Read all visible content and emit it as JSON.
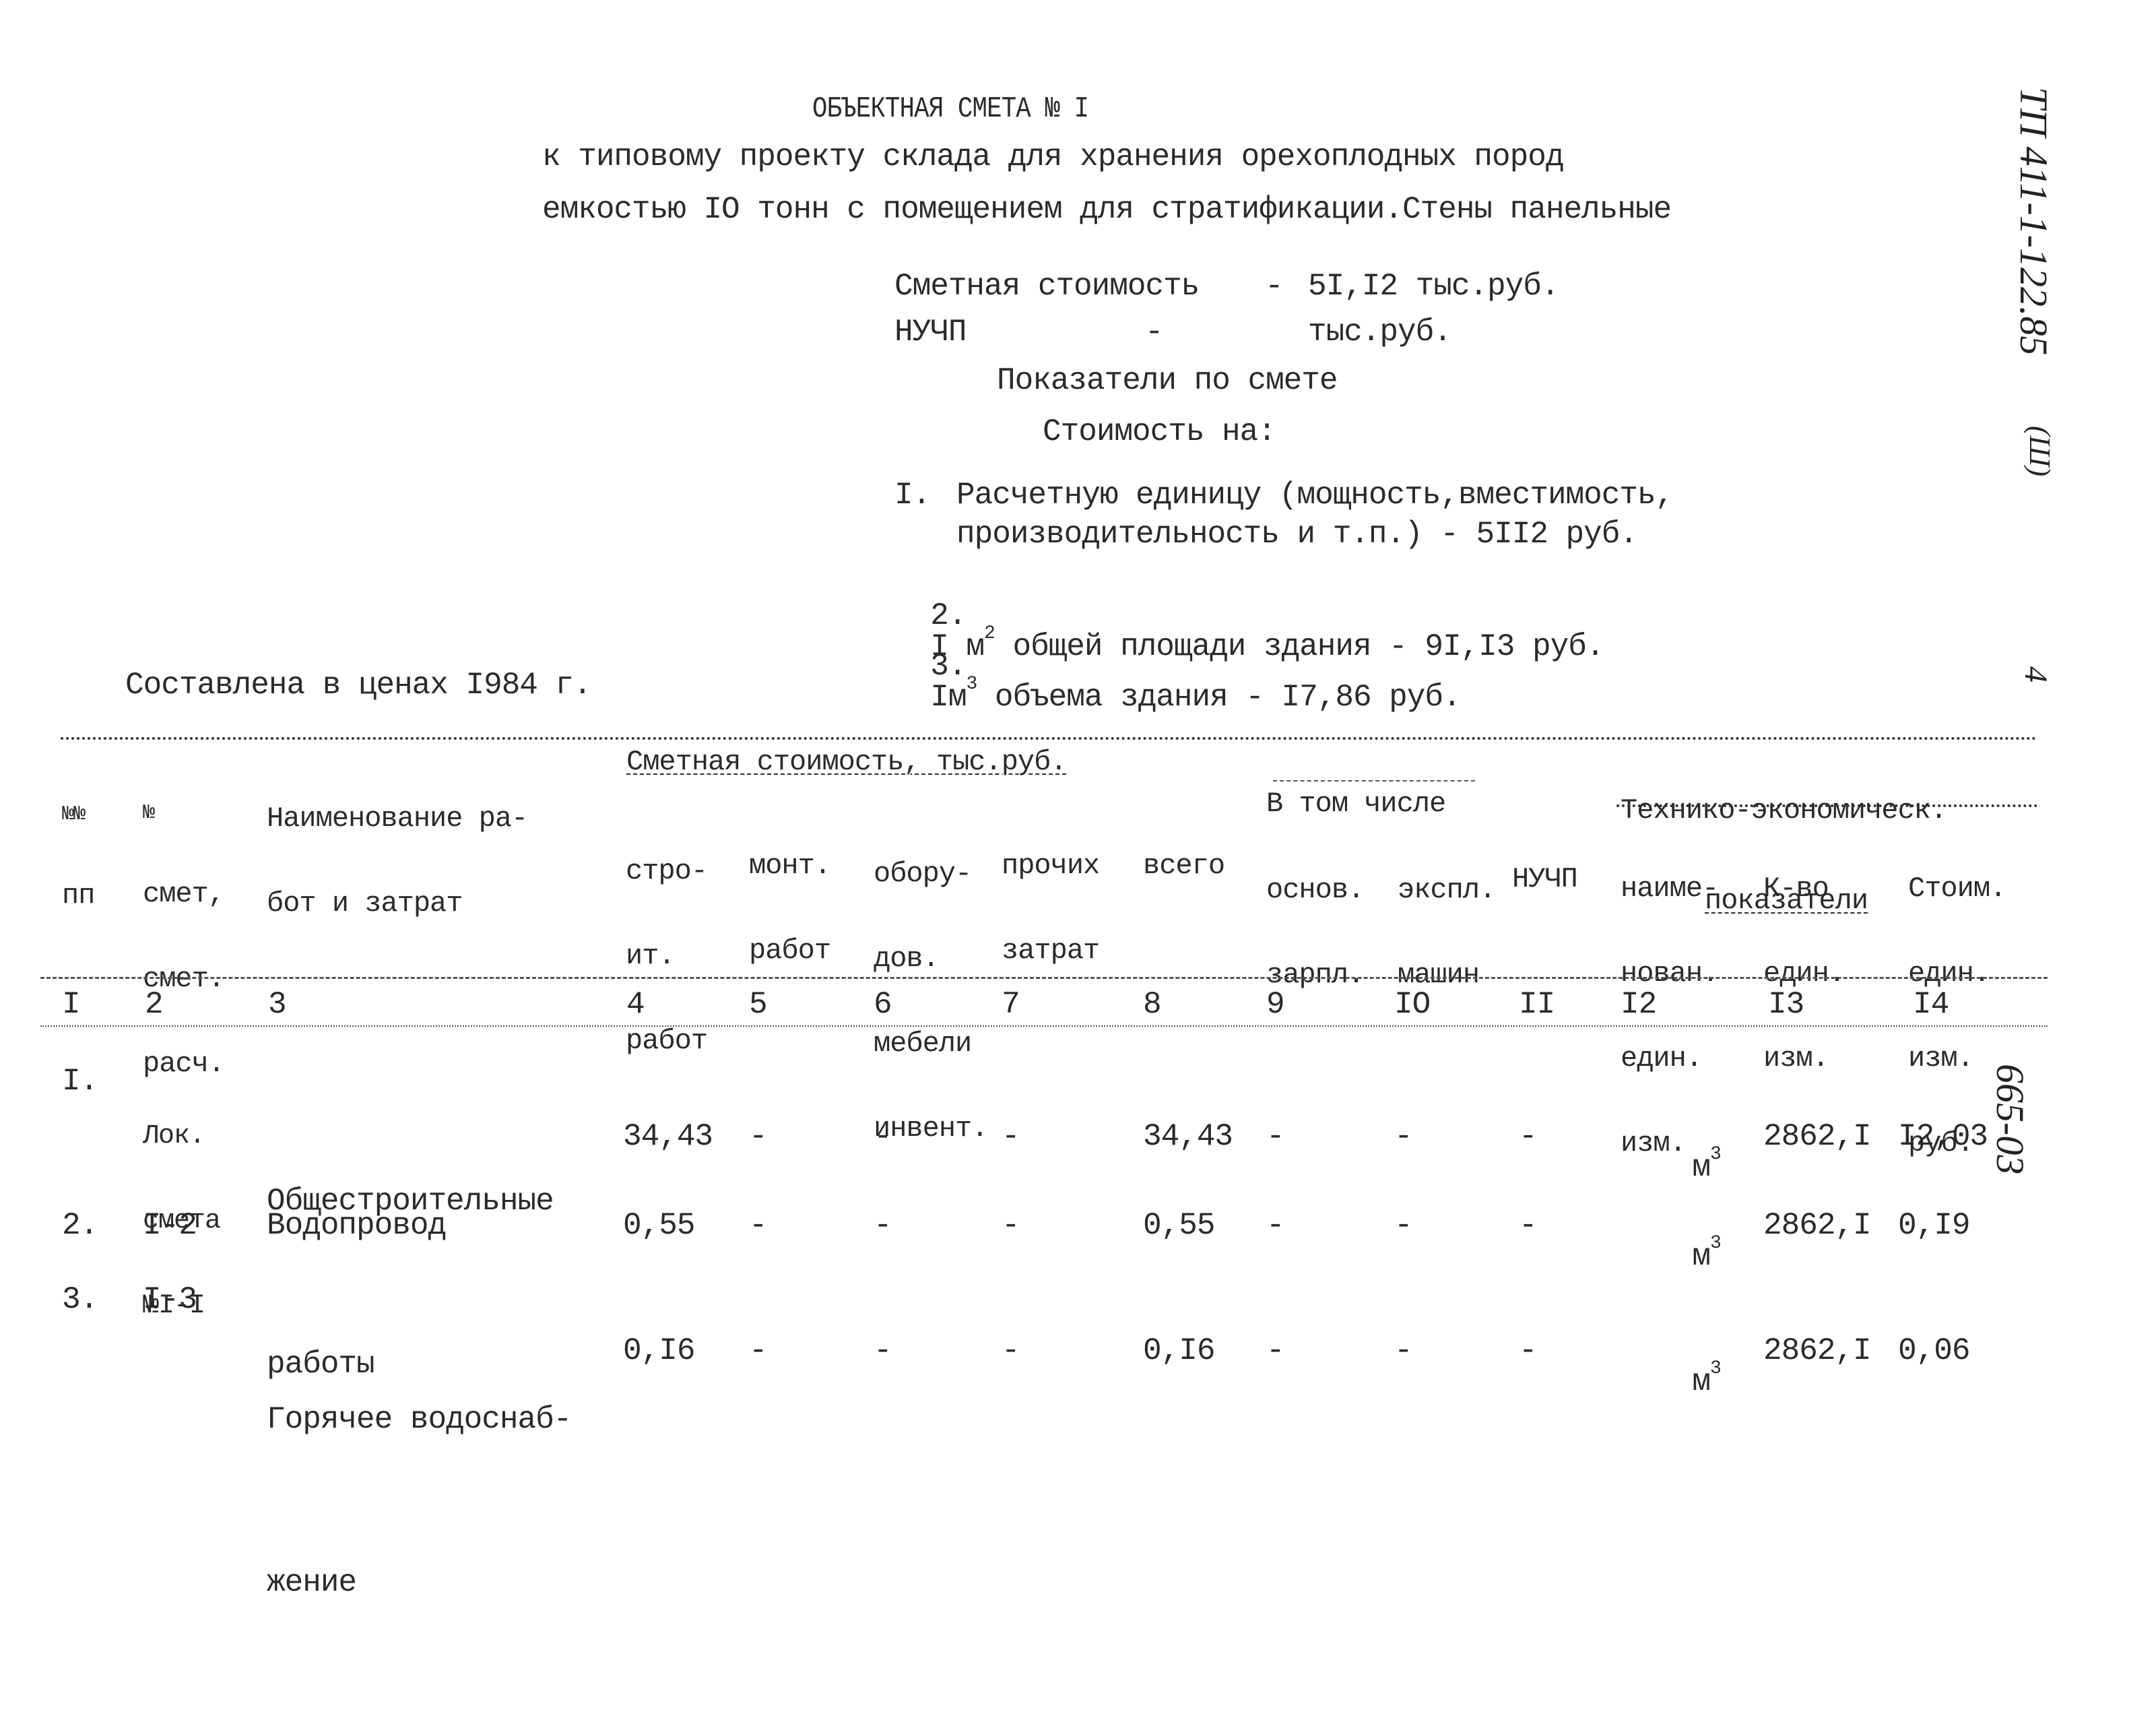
{
  "margin": {
    "document_code": "ТП 411-1-122.85",
    "album_mark": "(Ш)",
    "page_number": "4",
    "sheet_code": "665-03"
  },
  "header": {
    "title": "ОБЪЕКТНАЯ СМЕТА № I",
    "subtitle_line1": "к типовому проекту склада для хранения орехоплодных пород",
    "subtitle_line2": "емкостью IO тонн с помещением для стратификации.Стены панельные"
  },
  "summary": {
    "cost_label": "Сметная стоимость",
    "cost_dash": "-",
    "cost_value": "5I,I2 тыс.руб.",
    "nuchp_label": "НУЧП",
    "nuchp_dash": "-",
    "nuchp_value": "тыс.руб.",
    "indicators_title": "Показатели по смете",
    "cost_on_label": "Стоимость на:",
    "items": [
      {
        "num": "I.",
        "line1": "Расчетную единицу (мощность,вместимость,",
        "line2": "производительность и т.п.) - 5II2 руб."
      },
      {
        "num": "2.",
        "pre": "I м",
        "sup": "2",
        "post": " общей площади здания - 9I,I3 руб."
      },
      {
        "num": "3.",
        "pre": "Iм",
        "sup": "3",
        "post": " объема здания - I7,86 руб."
      }
    ],
    "prices_note": "Составлена в ценах I984 г."
  },
  "table": {
    "headers": {
      "c1": [
        "№№",
        "пп"
      ],
      "c2": [
        "№",
        "смет,",
        "смет.",
        "расч."
      ],
      "c3": [
        "Наименование ра-",
        "бот и затрат"
      ],
      "group_cost": "Сметная стоимость, тыс.руб.",
      "c4": [
        "стро-",
        "ит.",
        "работ"
      ],
      "c5": [
        "монт.",
        "работ"
      ],
      "c6": [
        "обору-",
        "дов.",
        "мебели",
        "инвент."
      ],
      "c7": [
        "прочих",
        "затрат"
      ],
      "c8": [
        "всего"
      ],
      "group_incl": [
        "В том числе"
      ],
      "c9": [
        "основ.",
        "зарпл."
      ],
      "c10": [
        "экспл.",
        "машин"
      ],
      "c11": [
        "НУЧП"
      ],
      "group_tech": [
        "Технико-экономическ.",
        "показатели"
      ],
      "c12": [
        "наиме-",
        "нован.",
        "един.",
        "изм."
      ],
      "c13": [
        "К-во",
        "един.",
        "изм."
      ],
      "c14": [
        "Стоим.",
        "един.",
        "изм.",
        "руб."
      ]
    },
    "column_numbers": [
      "I",
      "2",
      "3",
      "4",
      "5",
      "6",
      "7",
      "8",
      "9",
      "IO",
      "II",
      "I2",
      "I3",
      "I4"
    ],
    "rows": [
      {
        "num": "I.",
        "estimate": [
          "Лок.",
          "смета",
          "№I-I"
        ],
        "name": [
          "Общестроительные",
          "работы"
        ],
        "construction": "34,43",
        "installation": "-",
        "equipment": "-",
        "other": "-",
        "total": "34,43",
        "wages": "-",
        "machines": "-",
        "nuchp": "-",
        "unit": "м",
        "unit_sup": "3",
        "quantity": "2862,I",
        "unit_cost": "I2,03"
      },
      {
        "num": "2.",
        "estimate": [
          "I-2"
        ],
        "name": [
          "Водопровод"
        ],
        "construction": "0,55",
        "installation": "-",
        "equipment": "-",
        "other": "-",
        "total": "0,55",
        "wages": "-",
        "machines": "-",
        "nuchp": "-",
        "unit": "м",
        "unit_sup": "3",
        "quantity": "2862,I",
        "unit_cost": "0,I9"
      },
      {
        "num": "3.",
        "estimate": [
          "I-3"
        ],
        "name": [
          "Горячее водоснаб-",
          "жение"
        ],
        "construction": "0,I6",
        "installation": "-",
        "equipment": "-",
        "other": "-",
        "total": "0,I6",
        "wages": "-",
        "machines": "-",
        "nuchp": "-",
        "unit": "м",
        "unit_sup": "3",
        "quantity": "2862,I",
        "unit_cost": "0,06"
      }
    ]
  }
}
